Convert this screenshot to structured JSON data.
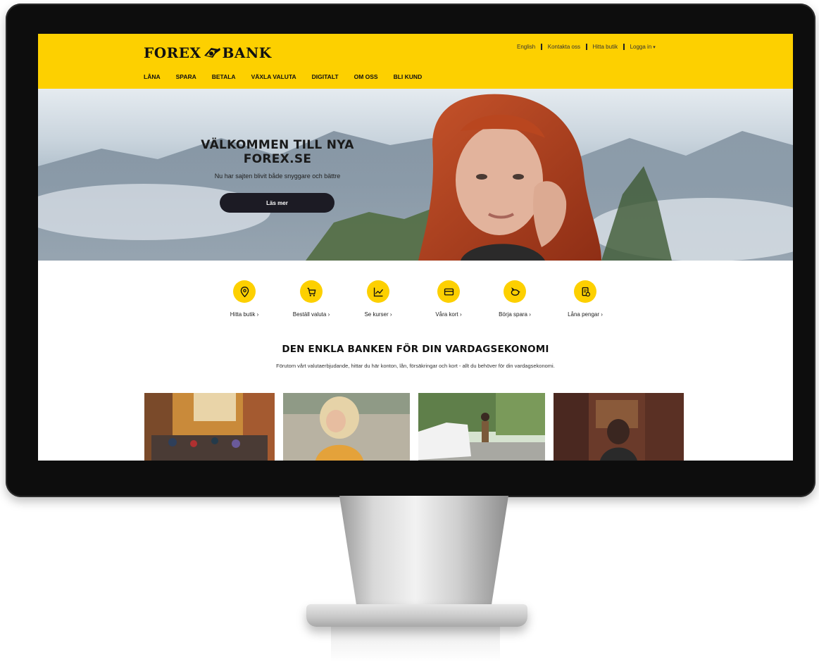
{
  "brand": {
    "logo_left": "FOREX",
    "logo_right": "BANK",
    "primary_color": "#fdd000",
    "dark_color": "#1c1b24"
  },
  "utility_nav": {
    "english": "English",
    "contact": "Kontakta oss",
    "find_store": "Hitta butik",
    "login": "Logga in"
  },
  "main_nav": [
    "LÅNA",
    "SPARA",
    "BETALA",
    "VÄXLA VALUTA",
    "DIGITALT",
    "OM OSS",
    "BLI KUND"
  ],
  "hero": {
    "title_line1": "VÄLKOMMEN TILL NYA",
    "title_line2": "FOREX.SE",
    "subtitle": "Nu har sajten blivit både snyggare och bättre",
    "cta": "Läs mer"
  },
  "quick_links": [
    {
      "label": "Hitta butik",
      "icon": "location-pin-icon"
    },
    {
      "label": "Beställ valuta",
      "icon": "shopping-cart-icon"
    },
    {
      "label": "Se kurser",
      "icon": "chart-icon"
    },
    {
      "label": "Våra kort",
      "icon": "credit-card-icon"
    },
    {
      "label": "Börja spara",
      "icon": "piggy-bank-icon"
    },
    {
      "label": "Låna pengar",
      "icon": "loan-document-icon"
    }
  ],
  "section": {
    "title": "DEN ENKLA BANKEN FÖR DIN VARDAGSEKONOMI",
    "text": "Förutom vårt valutaerbjudande, hittar du här konton, lån, försäkringar och kort - allt du behöver för din vardagsekonomi."
  }
}
